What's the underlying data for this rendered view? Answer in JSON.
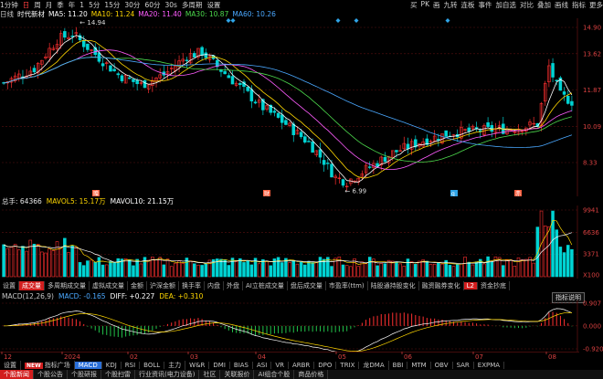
{
  "toolbar": {
    "items": [
      "1分钟",
      "日",
      "周",
      "月",
      "季",
      "年",
      "1",
      "5分",
      "15分",
      "30分",
      "60分",
      "30s",
      "多周期",
      "设置"
    ],
    "active_index": 1,
    "right_items": [
      "买",
      "PK",
      "画",
      "九转",
      "连板",
      "事件",
      "加自选",
      "对比",
      "叠加",
      "画线",
      "指标",
      "更多"
    ]
  },
  "ma_header": {
    "name": "时代新材",
    "prefix": "日线",
    "items": [
      {
        "label": "MA5: 11.20",
        "color": "#ffffff"
      },
      {
        "label": "MA10: 11.24",
        "color": "#ffd700"
      },
      {
        "label": "MA20: 11.40",
        "color": "#ff5cff"
      },
      {
        "label": "MA30: 10.87",
        "color": "#4cd94c"
      },
      {
        "label": "MA60: 10.26",
        "color": "#4aa8ff"
      }
    ]
  },
  "price_axis": [
    "14.90",
    "13.62",
    "11.87",
    "10.09",
    "8.33"
  ],
  "price_labels": {
    "high": "14.94",
    "low": "6.99"
  },
  "event_markers": [
    "赠",
    "财",
    "q",
    "赤"
  ],
  "volume_header": [
    {
      "label": "总手: 64366",
      "color": "#e6e6e6"
    },
    {
      "label": "MAVOL5: 15.17万",
      "color": "#ffd700"
    },
    {
      "label": "MAVOL10: 21.15万",
      "color": "#ffffff"
    }
  ],
  "volume_axis": [
    "9941",
    "6636",
    "3371",
    "X100"
  ],
  "indicator_tabs": [
    "设置",
    "成交量",
    "多周期成交量",
    "虚拟成交量",
    "金额",
    "沪深金额",
    "换手率",
    "内盘",
    "外盘",
    "AI立桩成交量",
    "盘后成交量",
    "市盈率(ttm)",
    "陆股通持股变化",
    "融资融券变化",
    "资金抄底"
  ],
  "indicator_selected": 1,
  "indicator_badge": "L2",
  "indicator_btn": "指标说明",
  "macd_header": [
    {
      "label": "MACD(12,26,9)",
      "color": "#c8c8c8"
    },
    {
      "label": "MACD: -0.165",
      "color": "#4aa8ff"
    },
    {
      "label": "DIFF: +0.227",
      "color": "#ffffff"
    },
    {
      "label": "DEA: +0.310",
      "color": "#ffd700"
    }
  ],
  "macd_axis": [
    "0.907",
    "0.000",
    "-0.920"
  ],
  "dates": [
    "12",
    "2024",
    "02",
    "03",
    "04",
    "05",
    "06",
    "07",
    "08"
  ],
  "bottom_tabs1": {
    "items": [
      "设置",
      "指标广场",
      "MACD",
      "KDJ",
      "RSI",
      "BOLL",
      "主力",
      "W&R",
      "DMI",
      "BIAS",
      "ASI",
      "VR",
      "ARBR",
      "DPO",
      "TRIX",
      "龙DMA",
      "BBI",
      "MTM",
      "OBV",
      "SAR",
      "EXPMA"
    ],
    "selected": 2,
    "badge": "NEW"
  },
  "bottom_tabs2": {
    "items": [
      "个股新闻",
      "个股公告",
      "个股研报",
      "个股扫雷",
      "行业资讯(电力设备)",
      "社区",
      "关联报价",
      "AI组合个股",
      "商品价格"
    ],
    "selected": 0
  },
  "colors": {
    "up": "#ff3030",
    "down": "#00d4d4",
    "grid": "#5a1010"
  }
}
